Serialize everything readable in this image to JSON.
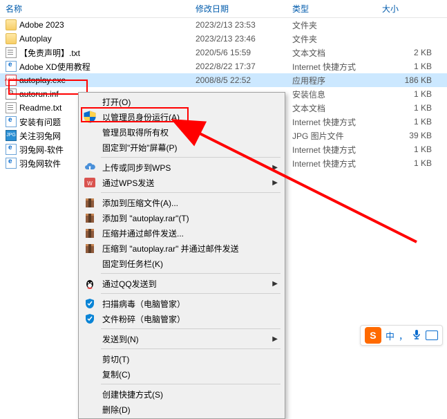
{
  "columns": {
    "name": "名称",
    "date": "修改日期",
    "type": "类型",
    "size": "大小"
  },
  "rows": [
    {
      "icon": "folder",
      "name": "Adobe 2023",
      "date": "2023/2/13 23:53",
      "type": "文件夹",
      "size": ""
    },
    {
      "icon": "folder",
      "name": "Autoplay",
      "date": "2023/2/13 23:46",
      "type": "文件夹",
      "size": ""
    },
    {
      "icon": "txt",
      "name": "【免责声明】.txt",
      "date": "2020/5/6 15:59",
      "type": "文本文档",
      "size": "2 KB"
    },
    {
      "icon": "url",
      "name": "Adobe XD使用教程",
      "date": "2022/8/22 17:37",
      "type": "Internet 快捷方式",
      "size": "1 KB"
    },
    {
      "icon": "exe",
      "name": "autoplay.exe",
      "date": "2008/8/5 22:52",
      "type": "应用程序",
      "size": "186 KB",
      "selected": true
    },
    {
      "icon": "inf",
      "name": "autorun.inf",
      "date": "",
      "type": "安装信息",
      "size": "1 KB"
    },
    {
      "icon": "txt",
      "name": "Readme.txt",
      "date": "",
      "type": "文本文档",
      "size": "1 KB"
    },
    {
      "icon": "url",
      "name": "安装有问题",
      "date": "",
      "type": "Internet 快捷方式",
      "size": "1 KB"
    },
    {
      "icon": "jpg",
      "name": "关注羽兔网",
      "date": "",
      "type": "JPG 图片文件",
      "size": "39 KB"
    },
    {
      "icon": "url",
      "name": "羽兔网-软件",
      "date": "",
      "type": "Internet 快捷方式",
      "size": "1 KB"
    },
    {
      "icon": "url",
      "name": "羽兔网软件",
      "date": "",
      "type": "Internet 快捷方式",
      "size": "1 KB"
    }
  ],
  "menu": [
    {
      "label": "打开(O)",
      "icon": ""
    },
    {
      "label": "以管理员身份运行(A)",
      "icon": "shield",
      "highlight": true
    },
    {
      "label": "管理员取得所有权",
      "icon": ""
    },
    {
      "label": "固定到\"开始\"屏幕(P)",
      "icon": ""
    },
    {
      "sep": true
    },
    {
      "label": "上传或同步到WPS",
      "icon": "cloud",
      "sub": true
    },
    {
      "label": "通过WPS发送",
      "icon": "wps",
      "sub": true
    },
    {
      "sep": true
    },
    {
      "label": "添加到压缩文件(A)...",
      "icon": "rar"
    },
    {
      "label": "添加到 \"autoplay.rar\"(T)",
      "icon": "rar"
    },
    {
      "label": "压缩并通过邮件发送...",
      "icon": "rar"
    },
    {
      "label": "压缩到 \"autoplay.rar\" 并通过邮件发送",
      "icon": "rar"
    },
    {
      "label": "固定到任务栏(K)",
      "icon": ""
    },
    {
      "sep": true
    },
    {
      "label": "通过QQ发送到",
      "icon": "qq",
      "sub": true
    },
    {
      "sep": true
    },
    {
      "label": "扫描病毒（电脑管家）",
      "icon": "guanjia"
    },
    {
      "label": "文件粉碎（电脑管家）",
      "icon": "guanjia"
    },
    {
      "sep": true
    },
    {
      "label": "发送到(N)",
      "icon": "",
      "sub": true
    },
    {
      "sep": true
    },
    {
      "label": "剪切(T)",
      "icon": ""
    },
    {
      "label": "复制(C)",
      "icon": ""
    },
    {
      "sep": true
    },
    {
      "label": "创建快捷方式(S)",
      "icon": ""
    },
    {
      "label": "删除(D)",
      "icon": ""
    }
  ],
  "ime": {
    "logo": "S",
    "lang": "中",
    "punct": "，"
  }
}
